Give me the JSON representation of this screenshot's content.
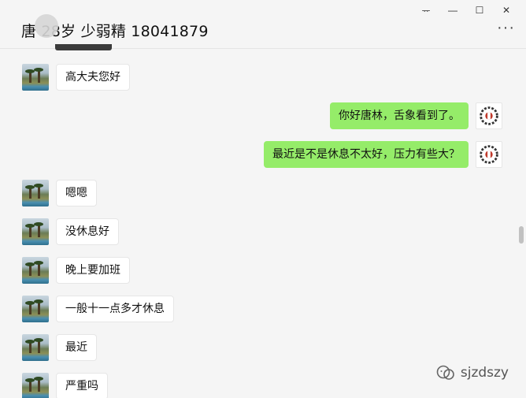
{
  "window_controls": {
    "pin": "ᅲ",
    "minimize": "—",
    "maximize": "☐",
    "close": "✕"
  },
  "header": {
    "title": "唐   28岁 少弱精 18041879",
    "more": "···"
  },
  "messages": [
    {
      "side": "left",
      "text": "高大夫您好"
    },
    {
      "side": "right",
      "text": "你好唐林，舌象看到了。"
    },
    {
      "side": "right",
      "text": "最近是不是休息不太好，压力有些大？"
    },
    {
      "side": "left",
      "text": "嗯嗯"
    },
    {
      "side": "left",
      "text": "没休息好"
    },
    {
      "side": "left",
      "text": "晚上要加班"
    },
    {
      "side": "left",
      "text": "一般十一点多才休息"
    },
    {
      "side": "left",
      "text": "最近"
    },
    {
      "side": "left",
      "text": "严重吗"
    }
  ],
  "watermark": {
    "text": "sjzdszy",
    "icon": "wechat-official-account-icon"
  },
  "colors": {
    "background": "#f5f5f5",
    "bubble_self": "#95ec69",
    "bubble_other": "#ffffff"
  }
}
